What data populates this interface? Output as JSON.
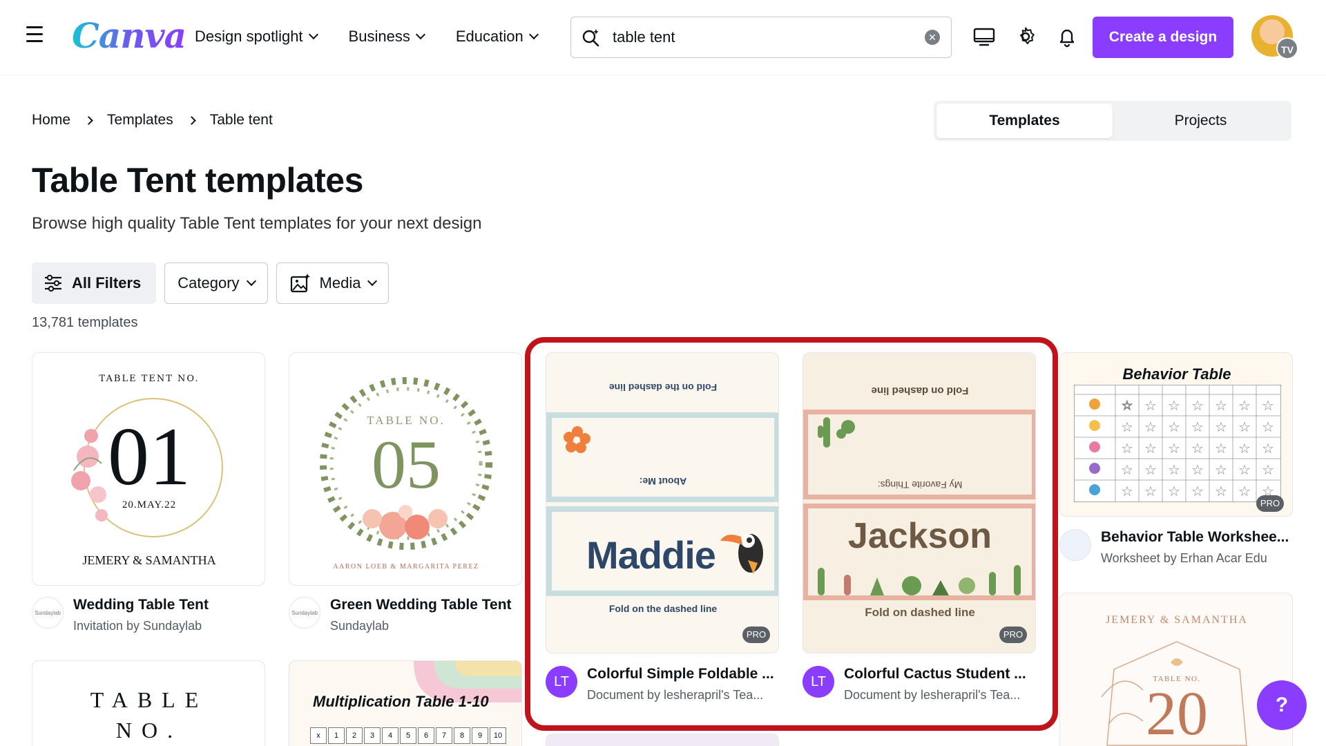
{
  "header": {
    "logo": "Canva",
    "nav": [
      {
        "label": "Design spotlight"
      },
      {
        "label": "Business"
      },
      {
        "label": "Education"
      }
    ],
    "search": {
      "value": "table tent",
      "placeholder": "Search"
    },
    "create_label": "Create a design",
    "avatar_initials": "TV"
  },
  "breadcrumb": [
    "Home",
    "Templates",
    "Table tent"
  ],
  "segment": {
    "templates": "Templates",
    "projects": "Projects"
  },
  "page": {
    "title": "Table Tent templates",
    "subtitle": "Browse high quality Table Tent templates for your next design"
  },
  "filters": {
    "all": "All Filters",
    "category": "Category",
    "media": "Media"
  },
  "count": "13,781 templates",
  "cards": [
    {
      "title": "Wedding Table Tent",
      "meta": "Invitation by Sundaylab",
      "logo": "Sundaylab",
      "thumb": {
        "top": "TABLE TENT NO.",
        "number": "01",
        "date": "20.MAY.22",
        "names": "JEMERY & SAMANTHA"
      }
    },
    {
      "title": "Green Wedding Table Tent",
      "meta": "Sundaylab",
      "logo": "Sundaylab",
      "thumb": {
        "top": "TABLE NO.",
        "number": "05",
        "names": "AARON LOEB & MARGARITA PEREZ"
      }
    },
    {
      "title": "Colorful Simple Foldable ...",
      "meta": "Document by lesherapril's Tea...",
      "logo": "LT",
      "thumb": {
        "fold_top": "Fold on the dashed line",
        "about": "About Me:",
        "name": "Maddie",
        "fold_bottom": "Fold on the dashed line"
      }
    },
    {
      "title": "Colorful Cactus Student ...",
      "meta": "Document by lesherapril's Tea...",
      "logo": "LT",
      "thumb": {
        "fold_top": "Fold on dashed line",
        "about": "My Favorite Things:",
        "name": "Jackson",
        "fold_bottom": "Fold on dashed line"
      }
    },
    {
      "title": "Behavior Table Workshee...",
      "meta": "Worksheet by Erhan Acar Edu",
      "thumb": {
        "heading": "Behavior Table"
      }
    },
    {
      "thumb": {
        "line1": "TABLE",
        "line2": "NO."
      }
    },
    {
      "thumb": {
        "heading": "Multiplication Table 1-10",
        "nums": [
          "x",
          "1",
          "2",
          "3",
          "4",
          "5",
          "6",
          "7",
          "8",
          "9",
          "10"
        ]
      }
    },
    {
      "thumb": {
        "names": "JEMERY & SAMANTHA",
        "label": "TABLE NO.",
        "number": "20"
      }
    }
  ],
  "pro_badge": "PRO",
  "help": "?"
}
